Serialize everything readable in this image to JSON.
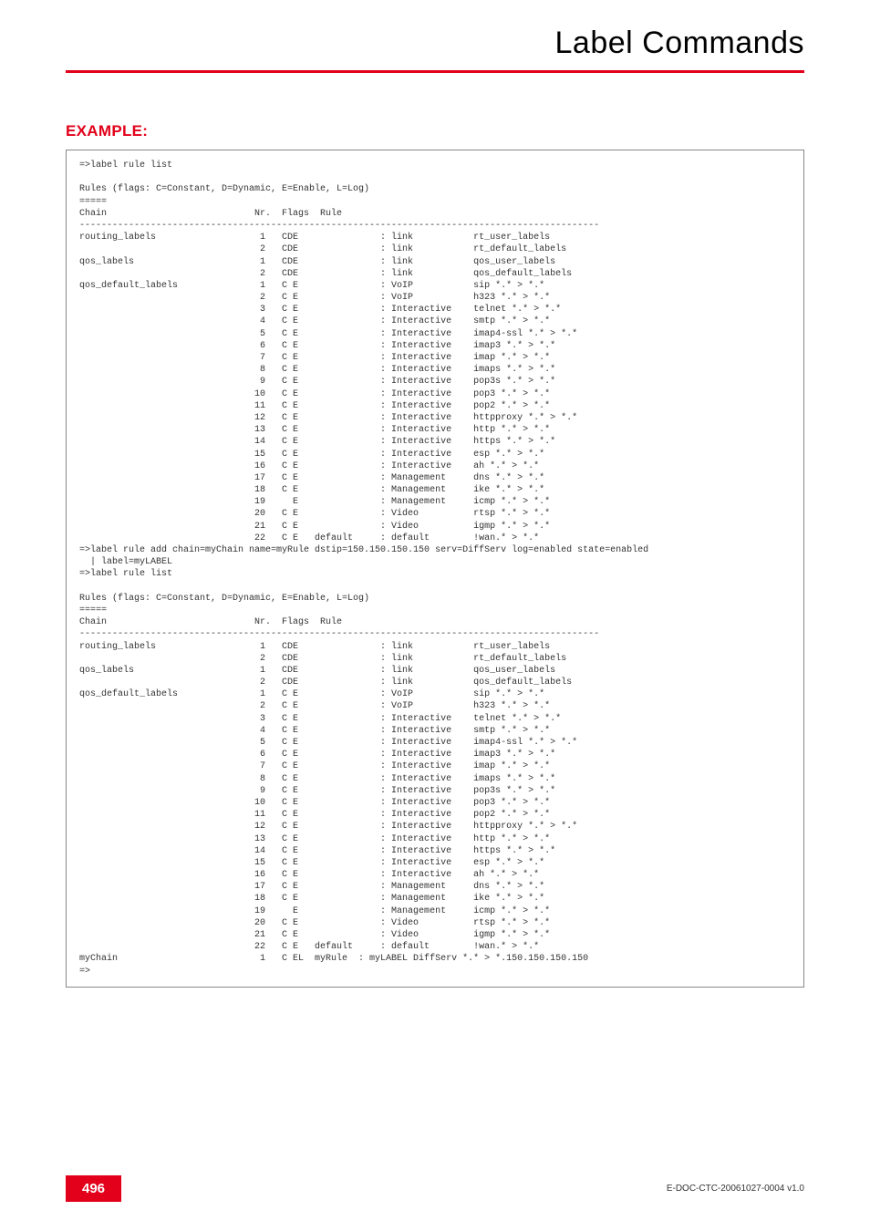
{
  "header": {
    "title": "Label Commands"
  },
  "section": {
    "example_label": "EXAMPLE:"
  },
  "footer": {
    "page_number": "496",
    "doc_id": "E-DOC-CTC-20061027-0004 v1.0"
  },
  "code": {
    "cmd1": "=>label rule list",
    "legend": "Rules (flags: C=Constant, D=Dynamic, E=Enable, L=Log)",
    "eq": "=====",
    "header_cols": "Chain                           Nr.  Flags  Rule",
    "dash": "-----------------------------------------------------------------------------------------------",
    "add_cmd": "=>label rule add chain=myChain name=myRule dstip=150.150.150.150 serv=DiffServ log=enabled state=enabled",
    "add_cmd_cont": "  | label=myLABEL",
    "cmd2": "=>label rule list",
    "prompt": "=>",
    "mychain_row": {
      "chain": "myChain",
      "nr": "1",
      "flags": "C EL",
      "rule": "myRule",
      "desc": ": myLABEL DiffServ *.* > *.150.150.150.150"
    },
    "rows": [
      {
        "chain": "routing_labels",
        "nr": "1",
        "flags": "CDE",
        "rule": "",
        "mid": ": link",
        "right": "rt_user_labels"
      },
      {
        "chain": "",
        "nr": "2",
        "flags": "CDE",
        "rule": "",
        "mid": ": link",
        "right": "rt_default_labels"
      },
      {
        "chain": "qos_labels",
        "nr": "1",
        "flags": "CDE",
        "rule": "",
        "mid": ": link",
        "right": "qos_user_labels"
      },
      {
        "chain": "",
        "nr": "2",
        "flags": "CDE",
        "rule": "",
        "mid": ": link",
        "right": "qos_default_labels"
      },
      {
        "chain": "qos_default_labels",
        "nr": "1",
        "flags": "C E",
        "rule": "",
        "mid": ": VoIP",
        "right": "sip *.* > *.*"
      },
      {
        "chain": "",
        "nr": "2",
        "flags": "C E",
        "rule": "",
        "mid": ": VoIP",
        "right": "h323 *.* > *.*"
      },
      {
        "chain": "",
        "nr": "3",
        "flags": "C E",
        "rule": "",
        "mid": ": Interactive",
        "right": "telnet *.* > *.*"
      },
      {
        "chain": "",
        "nr": "4",
        "flags": "C E",
        "rule": "",
        "mid": ": Interactive",
        "right": "smtp *.* > *.*"
      },
      {
        "chain": "",
        "nr": "5",
        "flags": "C E",
        "rule": "",
        "mid": ": Interactive",
        "right": "imap4-ssl *.* > *.*"
      },
      {
        "chain": "",
        "nr": "6",
        "flags": "C E",
        "rule": "",
        "mid": ": Interactive",
        "right": "imap3 *.* > *.*"
      },
      {
        "chain": "",
        "nr": "7",
        "flags": "C E",
        "rule": "",
        "mid": ": Interactive",
        "right": "imap *.* > *.*"
      },
      {
        "chain": "",
        "nr": "8",
        "flags": "C E",
        "rule": "",
        "mid": ": Interactive",
        "right": "imaps *.* > *.*"
      },
      {
        "chain": "",
        "nr": "9",
        "flags": "C E",
        "rule": "",
        "mid": ": Interactive",
        "right": "pop3s *.* > *.*"
      },
      {
        "chain": "",
        "nr": "10",
        "flags": "C E",
        "rule": "",
        "mid": ": Interactive",
        "right": "pop3 *.* > *.*"
      },
      {
        "chain": "",
        "nr": "11",
        "flags": "C E",
        "rule": "",
        "mid": ": Interactive",
        "right": "pop2 *.* > *.*"
      },
      {
        "chain": "",
        "nr": "12",
        "flags": "C E",
        "rule": "",
        "mid": ": Interactive",
        "right": "httpproxy *.* > *.*"
      },
      {
        "chain": "",
        "nr": "13",
        "flags": "C E",
        "rule": "",
        "mid": ": Interactive",
        "right": "http *.* > *.*"
      },
      {
        "chain": "",
        "nr": "14",
        "flags": "C E",
        "rule": "",
        "mid": ": Interactive",
        "right": "https *.* > *.*"
      },
      {
        "chain": "",
        "nr": "15",
        "flags": "C E",
        "rule": "",
        "mid": ": Interactive",
        "right": "esp *.* > *.*"
      },
      {
        "chain": "",
        "nr": "16",
        "flags": "C E",
        "rule": "",
        "mid": ": Interactive",
        "right": "ah *.* > *.*"
      },
      {
        "chain": "",
        "nr": "17",
        "flags": "C E",
        "rule": "",
        "mid": ": Management",
        "right": "dns *.* > *.*"
      },
      {
        "chain": "",
        "nr": "18",
        "flags": "C E",
        "rule": "",
        "mid": ": Management",
        "right": "ike *.* > *.*"
      },
      {
        "chain": "",
        "nr": "19",
        "flags": "  E",
        "rule": "",
        "mid": ": Management",
        "right": "icmp *.* > *.*"
      },
      {
        "chain": "",
        "nr": "20",
        "flags": "C E",
        "rule": "",
        "mid": ": Video",
        "right": "rtsp *.* > *.*"
      },
      {
        "chain": "",
        "nr": "21",
        "flags": "C E",
        "rule": "",
        "mid": ": Video",
        "right": "igmp *.* > *.*"
      },
      {
        "chain": "",
        "nr": "22",
        "flags": "C E",
        "rule": "default",
        "mid": ": default",
        "right": "!wan.* > *.*"
      }
    ]
  }
}
